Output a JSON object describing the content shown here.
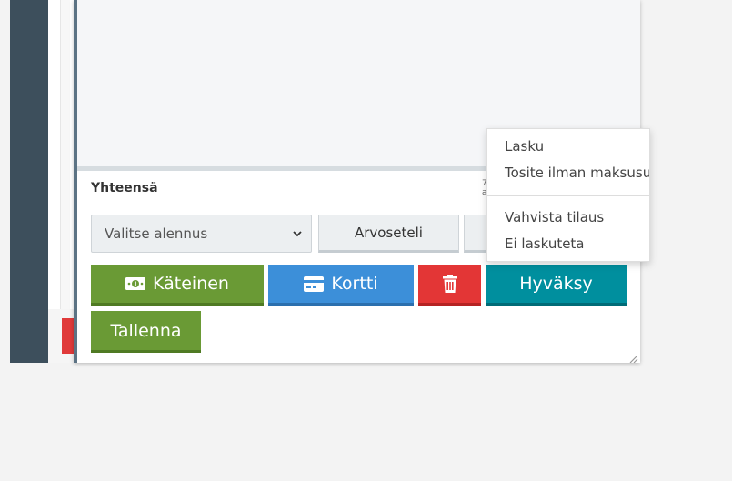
{
  "summary": {
    "total_label": "Yhteensä",
    "total_hint": "7 a"
  },
  "discount": {
    "selected": "Valitse alennus"
  },
  "buttons": {
    "voucher": "Arvoseteli",
    "cash": "Käteinen",
    "card": "Kortti",
    "approve": "Hyväksy",
    "save": "Tallenna"
  },
  "menu": {
    "items": [
      {
        "label": "Lasku"
      },
      {
        "label": "Tosite ilman maksusuoritusta"
      },
      {
        "label": "Vahvista tilaus"
      },
      {
        "label": "Ei laskuteta"
      }
    ]
  },
  "icons": {
    "cash": "money-bill-icon",
    "card": "credit-card-icon",
    "delete": "trash-icon",
    "select": "chevron-down-icon"
  },
  "colors": {
    "cash_green": "#6a9a35",
    "card_blue": "#3c8fd9",
    "delete_red": "#e33636",
    "approve_teal": "#008f9e",
    "sidebar": "#3d4f5c"
  }
}
